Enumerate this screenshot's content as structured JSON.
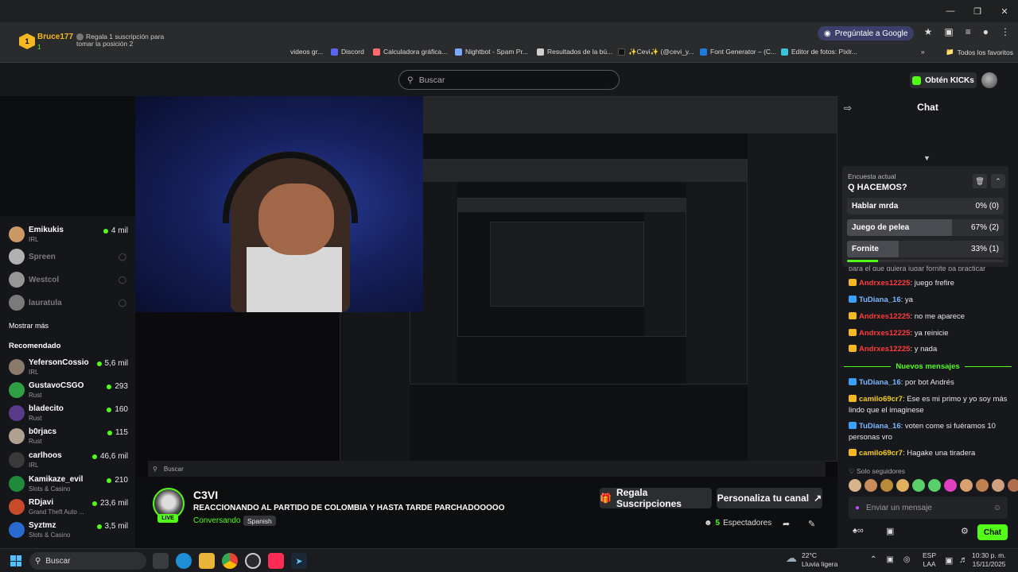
{
  "browser": {
    "google_button": "Pregúntale a Google",
    "bookmarks": [
      {
        "label": "videos gr...",
        "color": "#777777"
      },
      {
        "label": "Discord",
        "color": "#5865f2"
      },
      {
        "label": "Calculadora gráfica...",
        "color": "#ff6b6b"
      },
      {
        "label": "Nightbot - Spam Pr...",
        "color": "#7aa7ff"
      },
      {
        "label": "Resultados de la bú...",
        "color": "#d0d0d0"
      },
      {
        "label": "✨Cevi✨ (@cevi_y...",
        "color": "#111111"
      },
      {
        "label": "Font Generator – (C...",
        "color": "#1f7ae0"
      },
      {
        "label": "Editor de fotos: Pixlr...",
        "color": "#38c3d6"
      }
    ],
    "all_favorites": "Todos los favoritos"
  },
  "header": {
    "search_placeholder": "Buscar",
    "kicks_button": "Obtén KICKs"
  },
  "sidebar": {
    "following": [
      {
        "name": "Emikukis",
        "category": "IRL",
        "viewers": "4 mil",
        "live": true,
        "color": "#c96"
      },
      {
        "name": "Spreen",
        "live": false,
        "color": "#aaa"
      },
      {
        "name": "Westcol",
        "live": false,
        "color": "#aaa"
      },
      {
        "name": "lauratula",
        "live": false,
        "color": "#aaa"
      }
    ],
    "show_more": "Mostrar más",
    "recommended_title": "Recomendado",
    "recommended": [
      {
        "name": "YefersonCossio",
        "category": "IRL",
        "viewers": "5,6 mil",
        "color": "#8a7a6a"
      },
      {
        "name": "GustavoCSGO",
        "category": "Rust",
        "viewers": "293",
        "color": "#2ea043"
      },
      {
        "name": "bladecito",
        "category": "Rust",
        "viewers": "160",
        "color": "#5a3a8a"
      },
      {
        "name": "b0rjacs",
        "category": "Rust",
        "viewers": "115",
        "color": "#b0a090"
      },
      {
        "name": "carlhoos",
        "category": "IRL",
        "viewers": "46,6 mil",
        "color": "#3a3a3a"
      },
      {
        "name": "Kamikaze_evil",
        "category": "Slots & Casino",
        "viewers": "210",
        "color": "#1f8a3a"
      },
      {
        "name": "RDjavi",
        "category": "Grand Theft Auto ...",
        "viewers": "23,6 mil",
        "color": "#c84a2a"
      },
      {
        "name": "Syztmz",
        "category": "Slots & Casino",
        "viewers": "3,5 mil",
        "color": "#2a6ad0"
      }
    ]
  },
  "channel": {
    "name": "C3VI",
    "title": "REACCIONANDO AL PARTIDO DE COLOMBIA Y HASTA TARDE PARCHADOOOOO",
    "status": "Conversando",
    "language": "Spanish",
    "live_label": "LIVE",
    "gift_button": "Regala Suscripciones",
    "customize_button": "Personaliza tu canal",
    "viewers_count": "5",
    "viewers_label": "Espectadores"
  },
  "chat": {
    "title": "Chat",
    "pinned_user": "Bruce177",
    "pinned_rank": "1",
    "pinned_sub": "1",
    "pinned_message": "Regala 1 suscripción para tomar la posición 2",
    "poll": {
      "label": "Encuesta actual",
      "question": "Q HACEMOS?",
      "options": [
        {
          "label": "Hablar mrda",
          "pct": "0% (0)",
          "fraction": 0.0
        },
        {
          "label": "Juego de pelea",
          "pct": "67% (2)",
          "fraction": 0.67
        },
        {
          "label": "Fornite",
          "pct": "33% (1)",
          "fraction": 0.33
        }
      ],
      "time_remaining_fraction": 0.2
    },
    "partial_line": "para el que quiera jugar fornite pa practicar",
    "messages": [
      {
        "user": "Andrxes12225",
        "text": ": juego frefire",
        "user_color": "#ff3b3b",
        "badge": "#f5b820"
      },
      {
        "user": "TuDiana_16",
        "text": ": ya",
        "user_color": "#7ab8ff",
        "badge": "#3aa0ff"
      },
      {
        "user": "Andrxes12225",
        "text": ": no me aparece",
        "user_color": "#ff3b3b",
        "badge": "#f5b820"
      },
      {
        "user": "Andrxes12225",
        "text": ": ya reinicie",
        "user_color": "#ff3b3b",
        "badge": "#f5b820"
      },
      {
        "user": "Andrxes12225",
        "text": ": y nada",
        "user_color": "#ff3b3b",
        "badge": "#f5b820"
      }
    ],
    "new_messages_label": "Nuevos mensajes",
    "new_messages": [
      {
        "user": "TuDiana_16",
        "text": ": por bot Andrés",
        "user_color": "#7ab8ff",
        "badge": "#3aa0ff"
      },
      {
        "user": "camilo69cr7",
        "text": ": Ese es mi primo y yo soy más lindo que el imaginese",
        "user_color": "#f5d020",
        "badge": "#f5b820"
      },
      {
        "user": "TuDiana_16",
        "text": ": voten come si fuéramos 10 personas vro",
        "user_color": "#7ab8ff",
        "badge": "#3aa0ff"
      },
      {
        "user": "camilo69cr7",
        "text": ": Hagake una tiradera",
        "user_color": "#f5d020",
        "badge": "#f5b820"
      }
    ],
    "followers_only": "Solo seguidores",
    "input_placeholder": "Enviar un mensaje",
    "send_button": "Chat"
  },
  "taskbar": {
    "search_placeholder": "Buscar",
    "weather_temp": "22°C",
    "weather_desc": "Lluvia ligera",
    "lang_line1": "ESP",
    "lang_line2": "LAA",
    "time": "10:30 p. m.",
    "date": "15/11/2025"
  }
}
